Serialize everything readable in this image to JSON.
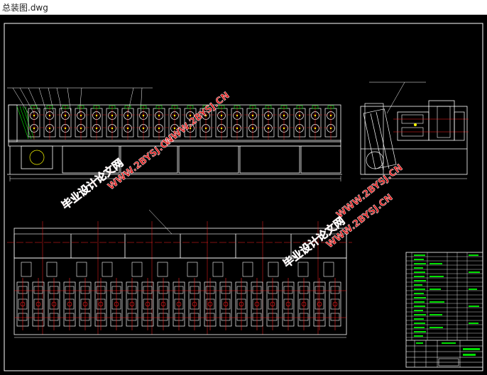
{
  "window": {
    "title": "总装图.dwg"
  },
  "watermarks": [
    {
      "text": "毕业设计论文网"
    },
    {
      "text": "WWW.2BYSJ.CN"
    }
  ],
  "colors": {
    "background": "#000000",
    "frame": "#ffffff",
    "centerline": "#ff2020",
    "accent_green": "#00e000",
    "accent_yellow": "#ffff00",
    "accent_cyan": "#00d0d0",
    "watermark": "#e01818"
  }
}
